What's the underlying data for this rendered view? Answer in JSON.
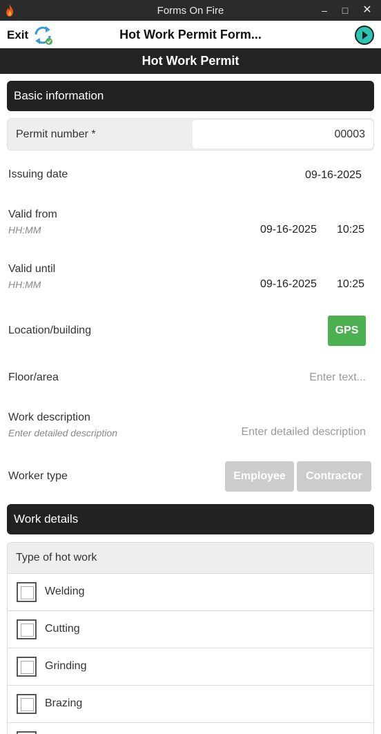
{
  "window": {
    "title": "Forms On Fire"
  },
  "header": {
    "exit_label": "Exit",
    "form_title": "Hot Work Permit Form..."
  },
  "page_title": "Hot Work Permit",
  "sections": {
    "basic": "Basic information",
    "work": "Work details"
  },
  "permit": {
    "label": "Permit number *",
    "value": "00003"
  },
  "issuing": {
    "label": "Issuing date",
    "value": "09-16-2025"
  },
  "valid_from": {
    "label": "Valid from",
    "hint": "HH:MM",
    "date": "09-16-2025",
    "time": "10:25"
  },
  "valid_until": {
    "label": "Valid until",
    "hint": "HH:MM",
    "date": "09-16-2025",
    "time": "10:25"
  },
  "location": {
    "label": "Location/building",
    "button": "GPS"
  },
  "floor": {
    "label": "Floor/area",
    "placeholder": "Enter text..."
  },
  "description": {
    "label": "Work description",
    "hint": "Enter detailed description",
    "placeholder": "Enter detailed description"
  },
  "worker_type": {
    "label": "Worker type",
    "options": [
      "Employee",
      "Contractor"
    ]
  },
  "hot_work": {
    "label": "Type of hot work",
    "options": [
      "Welding",
      "Cutting",
      "Grinding",
      "Brazing"
    ]
  },
  "colors": {
    "accent_green": "#4caf50",
    "section_bg": "#222222",
    "disabled_btn": "#cccccc",
    "next_teal": "#2cc4b4"
  }
}
